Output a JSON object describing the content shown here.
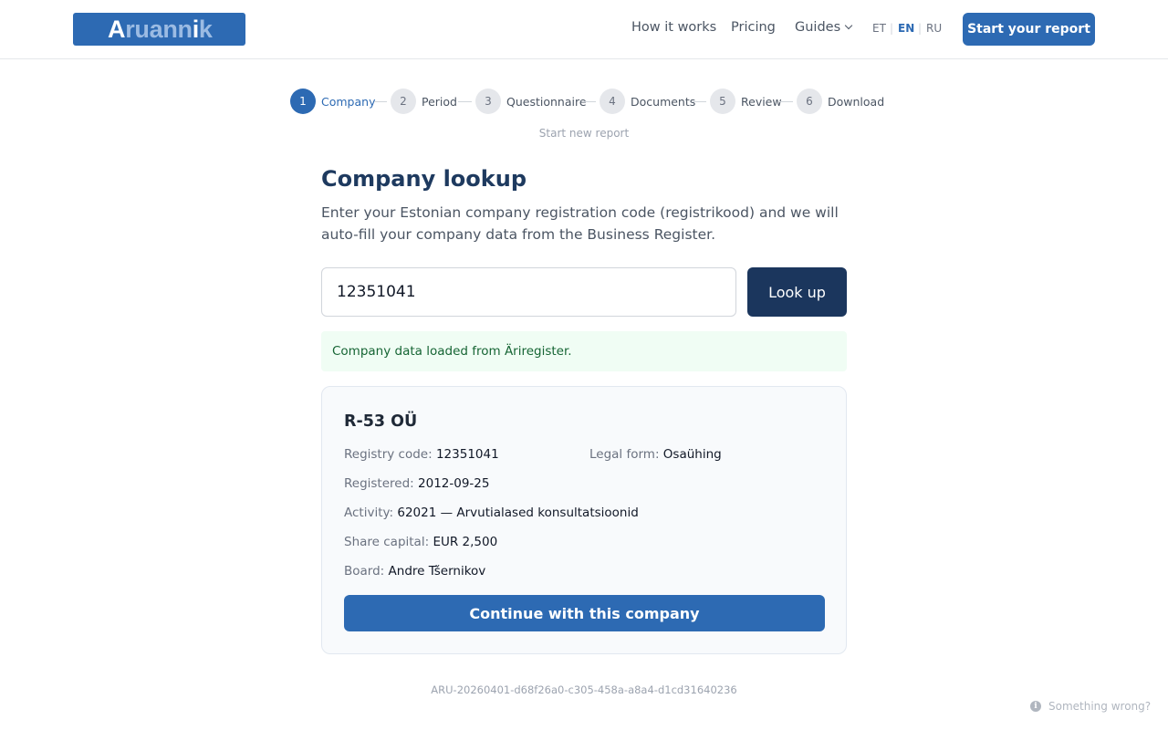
{
  "header": {
    "logo_text_1": "A",
    "logo_text_2": "ruann",
    "logo_text_3": "i",
    "logo_text_4": "k",
    "nav": [
      "How it works",
      "Pricing",
      "Guides"
    ],
    "languages": [
      "ET",
      "EN",
      "RU"
    ],
    "active_language": "EN",
    "cta": "Start your report"
  },
  "stepper": {
    "steps": [
      {
        "num": "1",
        "label": "Company"
      },
      {
        "num": "2",
        "label": "Period"
      },
      {
        "num": "3",
        "label": "Questionnaire"
      },
      {
        "num": "4",
        "label": "Documents"
      },
      {
        "num": "5",
        "label": "Review"
      },
      {
        "num": "6",
        "label": "Download"
      }
    ],
    "active_step": "1",
    "start_new": "Start new report"
  },
  "main": {
    "title": "Company lookup",
    "description": "Enter your Estonian company registration code (registrikood) and we will auto-fill your company data from the Business Register.",
    "input_value": "12351041",
    "lookup_button": "Look up",
    "success_message": "Company data loaded from Äriregister."
  },
  "company": {
    "name": "R-53 OÜ",
    "registry_code_label": "Registry code:",
    "registry_code": "12351041",
    "legal_form_label": "Legal form:",
    "legal_form": "Osaühing",
    "registered_label": "Registered:",
    "registered": "2012-09-25",
    "activity_label": "Activity:",
    "activity": "62021 — Arvutialased konsultatsioonid",
    "share_capital_label": "Share capital:",
    "share_capital": "EUR 2,500",
    "board_label": "Board:",
    "board": "Andre Tšernikov",
    "continue_button": "Continue with this company"
  },
  "footer": {
    "report_id": "ARU-20260401-d68f26a0-c305-458a-a8a4-d1cd31640236",
    "help_link": "Something wrong?"
  },
  "colors": {
    "brand": "#2d6ab3",
    "navy": "#1b365d",
    "success_bg": "#f0fdf4",
    "success_text": "#166534"
  }
}
